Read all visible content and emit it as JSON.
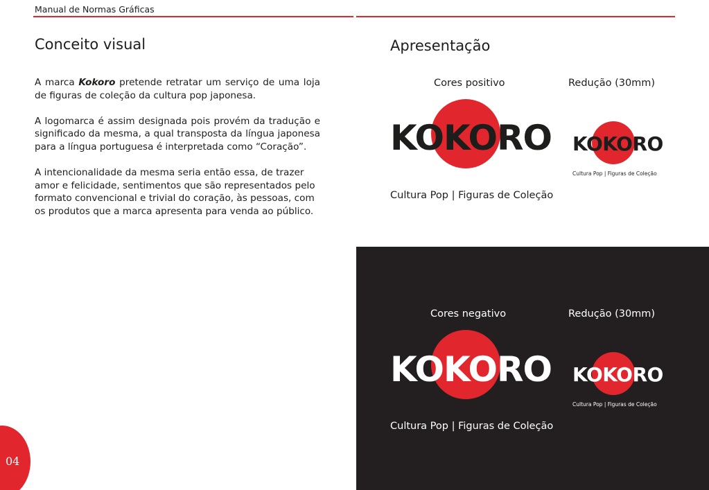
{
  "header": {
    "title": "Manual de Normas Gráficas"
  },
  "concept": {
    "title": "Conceito visual",
    "paragraph1": {
      "before": "A marca ",
      "brand": "Kokoro",
      "after": " pretende retratar um serviço de uma loja de figuras de coleção da cultura pop japonesa."
    },
    "paragraph2": "A logomarca é assim designada pois provém da tradução e significado da mesma, a qual transposta da língua japonesa para a língua portuguesa é interpretada como “Coração”.",
    "paragraph3": "A intencionalidade da mesma seria então essa, de trazer amor e felicidade, sentimentos que são representados pelo formato convencional e trivial do coração, às pessoas, com os produtos que a marca apresenta para venda ao público."
  },
  "presentation": {
    "title": "Apresentação",
    "positive": {
      "label": "Cores positivo",
      "reduction_label": "Redução (30mm)",
      "logo": "KOKORO",
      "tagline": "Cultura Pop | Figuras de Coleção"
    },
    "negative": {
      "label": "Cores negativo",
      "reduction_label": "Redução (30mm)",
      "logo": "KOKORO",
      "tagline": "Cultura Pop | Figuras de Coleção"
    }
  },
  "page": {
    "number": "04"
  },
  "colors": {
    "accent_red": "#e1272d",
    "dark_panel": "#231f20",
    "text": "#1d1d1b"
  }
}
